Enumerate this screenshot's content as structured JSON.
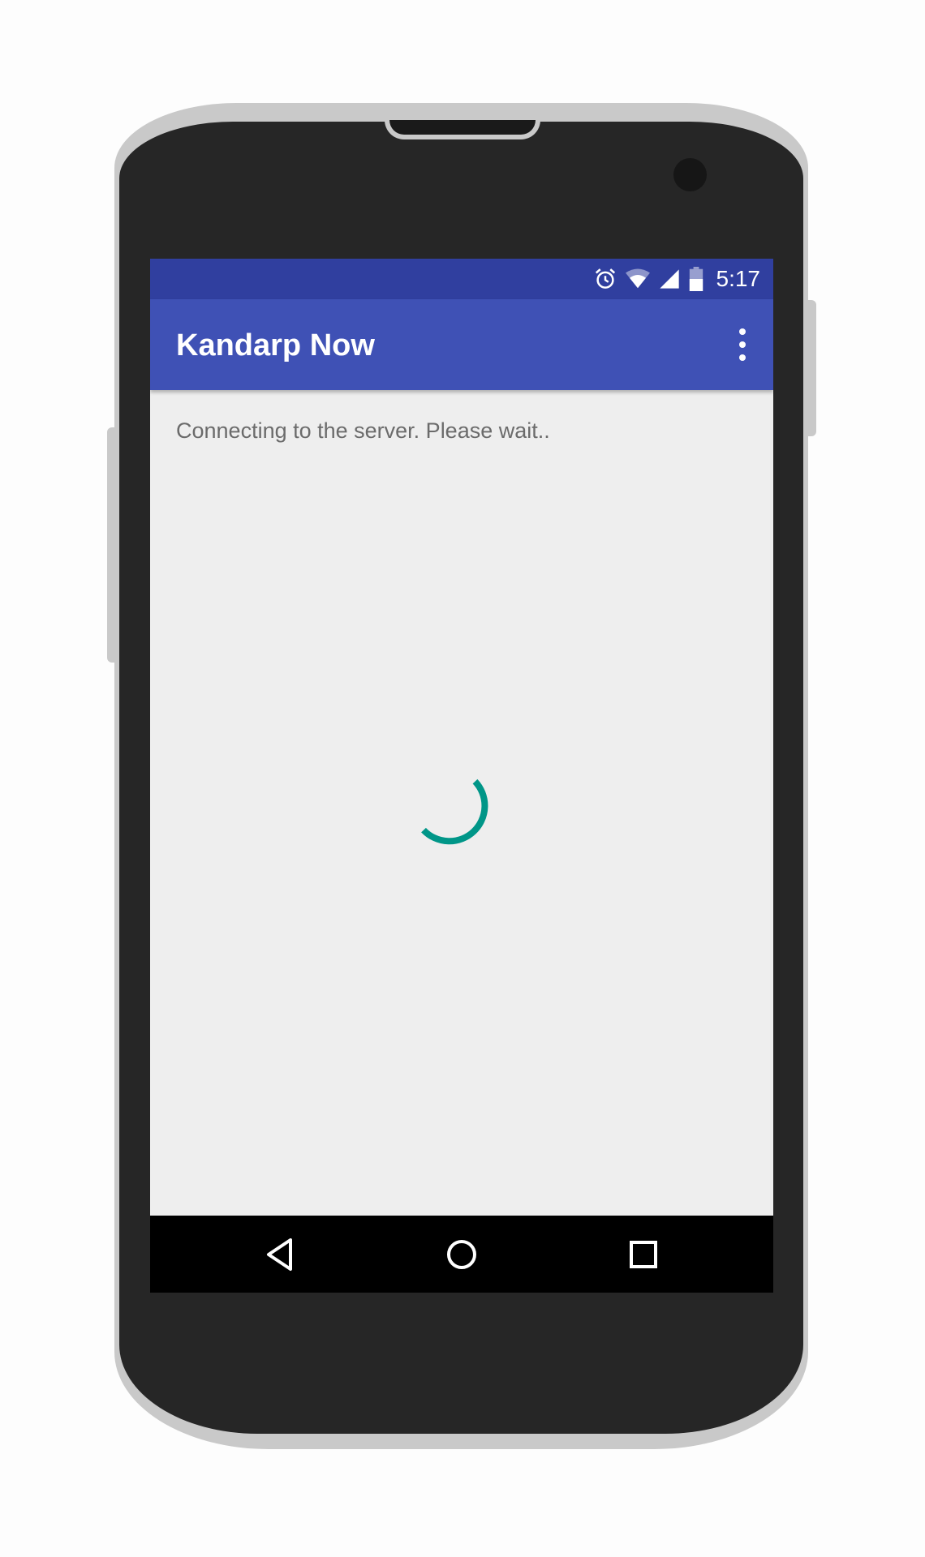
{
  "status_bar": {
    "time": "5:17",
    "icons": [
      "alarm-icon",
      "wifi-icon",
      "cell-signal-icon",
      "battery-icon"
    ]
  },
  "app_bar": {
    "title": "Kandarp Now",
    "menu_icon": "overflow-menu-icon"
  },
  "content": {
    "message": "Connecting to the server. Please wait.."
  },
  "nav_bar": {
    "buttons": [
      "back-icon",
      "home-icon",
      "recents-icon"
    ]
  },
  "colors": {
    "status_bar": "#303f9f",
    "app_bar": "#3f51b5",
    "background": "#eeeeee",
    "spinner": "#009688",
    "nav_bar": "#000000"
  }
}
